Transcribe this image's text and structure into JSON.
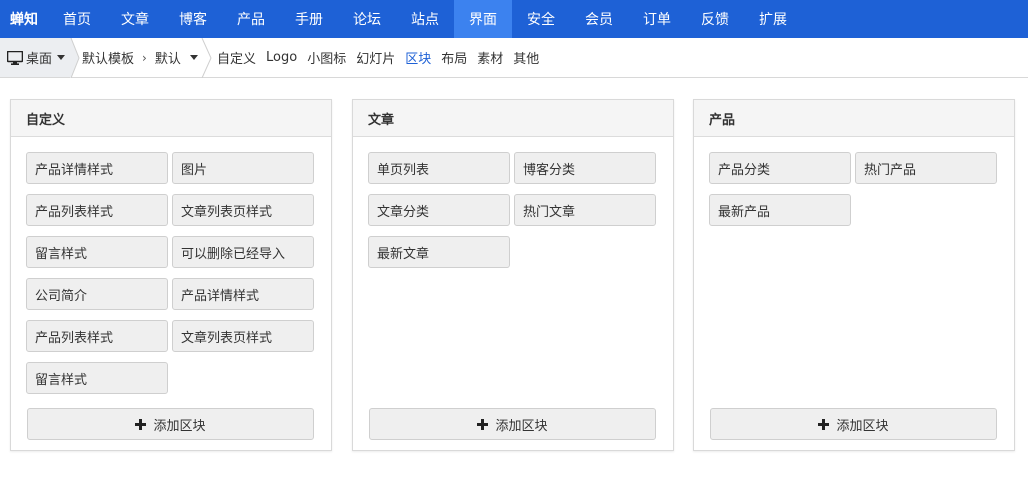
{
  "topnav": {
    "brand": "蝉知",
    "items": [
      {
        "label": "首页"
      },
      {
        "label": "文章"
      },
      {
        "label": "博客"
      },
      {
        "label": "产品"
      },
      {
        "label": "手册"
      },
      {
        "label": "论坛"
      },
      {
        "label": "站点"
      },
      {
        "label": "界面",
        "active": true
      },
      {
        "label": "安全"
      },
      {
        "label": "会员"
      },
      {
        "label": "订单"
      },
      {
        "label": "反馈"
      },
      {
        "label": "扩展"
      }
    ],
    "colors": {
      "bar": "#1e61d6",
      "active": "#3c82ef"
    }
  },
  "toolbar": {
    "device": {
      "label": "桌面",
      "icon": "desktop-icon"
    },
    "template": "默认模板",
    "theme": "默认",
    "subnav": [
      {
        "label": "自定义"
      },
      {
        "label": "Logo"
      },
      {
        "label": "小图标"
      },
      {
        "label": "幻灯片"
      },
      {
        "label": "区块",
        "active": true
      },
      {
        "label": "布局"
      },
      {
        "label": "素材"
      },
      {
        "label": "其他"
      }
    ]
  },
  "panels": [
    {
      "title": "自定义",
      "blocks": [
        "产品详情样式",
        "图片",
        "产品列表样式",
        "文章列表页样式",
        "留言样式",
        "可以删除已经导入",
        "公司简介",
        "产品详情样式",
        "产品列表样式",
        "文章列表页样式",
        "留言样式"
      ],
      "add_label": "添加区块"
    },
    {
      "title": "文章",
      "blocks": [
        "单页列表",
        "博客分类",
        "文章分类",
        "热门文章",
        "最新文章"
      ],
      "add_label": "添加区块"
    },
    {
      "title": "产品",
      "blocks": [
        "产品分类",
        "热门产品",
        "最新产品"
      ],
      "add_label": "添加区块"
    }
  ]
}
